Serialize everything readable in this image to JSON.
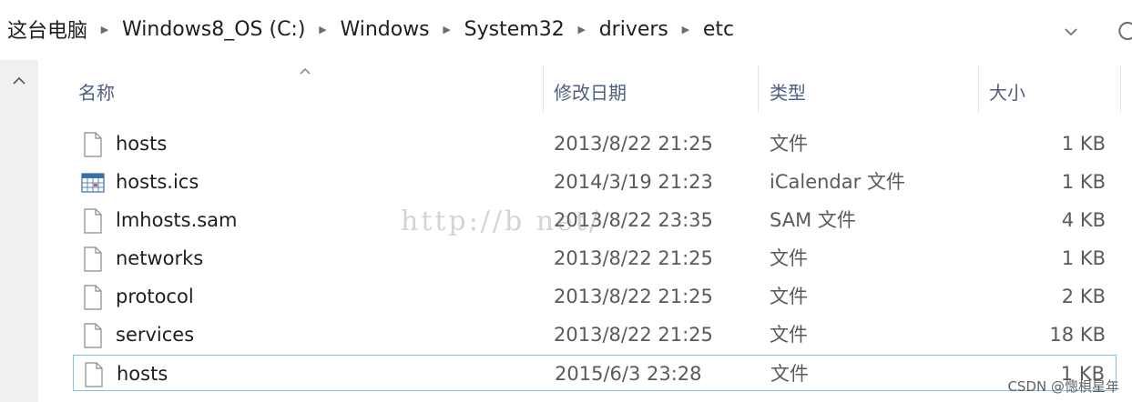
{
  "address_bar": {
    "crumbs": [
      "这台电脑",
      "Windows8_OS (C:)",
      "Windows",
      "System32",
      "drivers",
      "etc"
    ]
  },
  "columns": {
    "name": "名称",
    "date": "修改日期",
    "type": "类型",
    "size": "大小"
  },
  "files": [
    {
      "name": "hosts",
      "date": "2013/8/22 21:25",
      "type": "文件",
      "size": "1 KB",
      "icon": "blank-file-icon",
      "selected": false
    },
    {
      "name": "hosts.ics",
      "date": "2014/3/19 21:23",
      "type": "iCalendar 文件",
      "size": "1 KB",
      "icon": "calendar-file-icon",
      "selected": false
    },
    {
      "name": "lmhosts.sam",
      "date": "2013/8/22 23:35",
      "type": "SAM 文件",
      "size": "4 KB",
      "icon": "blank-file-icon",
      "selected": false
    },
    {
      "name": "networks",
      "date": "2013/8/22 21:25",
      "type": "文件",
      "size": "1 KB",
      "icon": "blank-file-icon",
      "selected": false
    },
    {
      "name": "protocol",
      "date": "2013/8/22 21:25",
      "type": "文件",
      "size": "2 KB",
      "icon": "blank-file-icon",
      "selected": false
    },
    {
      "name": "services",
      "date": "2013/8/22 21:25",
      "type": "文件",
      "size": "18 KB",
      "icon": "blank-file-icon",
      "selected": false
    },
    {
      "name": "hosts",
      "date": "2015/6/3 23:28",
      "type": "文件",
      "size": "1 KB",
      "icon": "blank-file-icon",
      "selected": true
    }
  ],
  "watermarks": {
    "blog": "http://b                    net/",
    "csdn": "CSDN @憁梖星年"
  },
  "colors": {
    "header_text": "#4d6082",
    "selection_border": "#7fc3e6",
    "scrollbar_bg": "#f0f0f0"
  }
}
